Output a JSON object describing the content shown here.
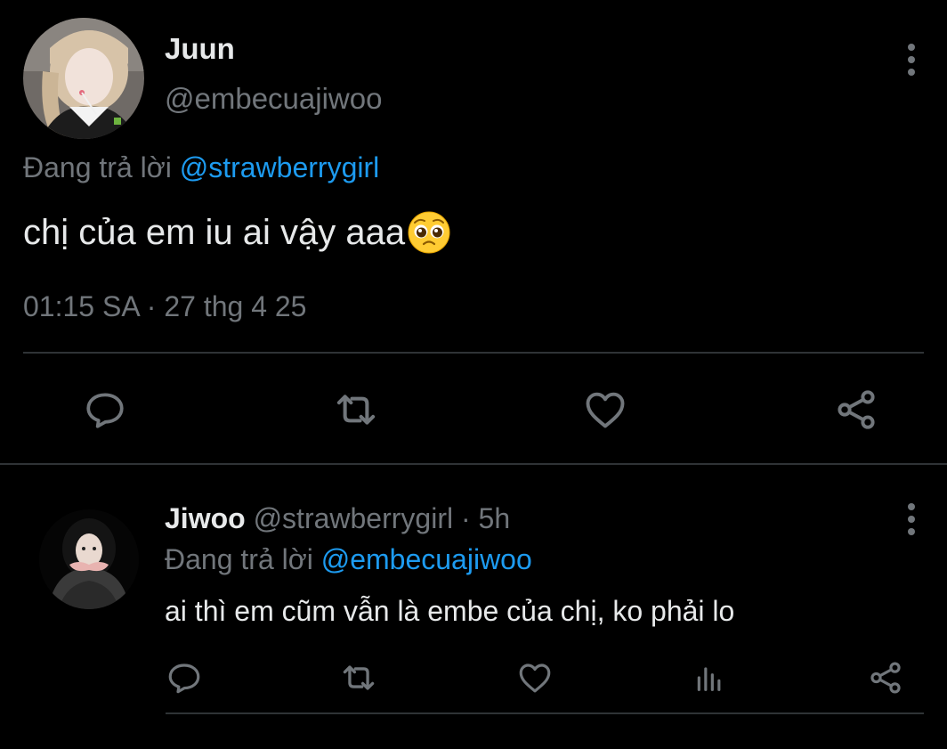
{
  "main_tweet": {
    "display_name": "Juun",
    "handle": "@embecuajiwoo",
    "replying_prefix": "Đang trả lời",
    "replying_to": "@strawberrygirl",
    "text": "chị của em iu ai vậy aaa",
    "emoji": "pleading-face",
    "timestamp": "01:15 SA · 27 thg 4 25",
    "actions": [
      "reply",
      "retweet",
      "like",
      "share"
    ]
  },
  "reply_tweet": {
    "display_name": "Jiwoo",
    "handle": "@strawberrygirl",
    "separator": "·",
    "time": "5h",
    "replying_prefix": "Đang trả lời",
    "replying_to": "@embecuajiwoo",
    "text": "ai thì em cũm vẫn là embe của chị, ko phải lo",
    "actions": [
      "reply",
      "retweet",
      "like",
      "views",
      "share"
    ]
  },
  "colors": {
    "background": "#000000",
    "text_primary": "#e7e9ea",
    "text_secondary": "#71767b",
    "link": "#1d9bf0",
    "divider": "#2f3336"
  }
}
